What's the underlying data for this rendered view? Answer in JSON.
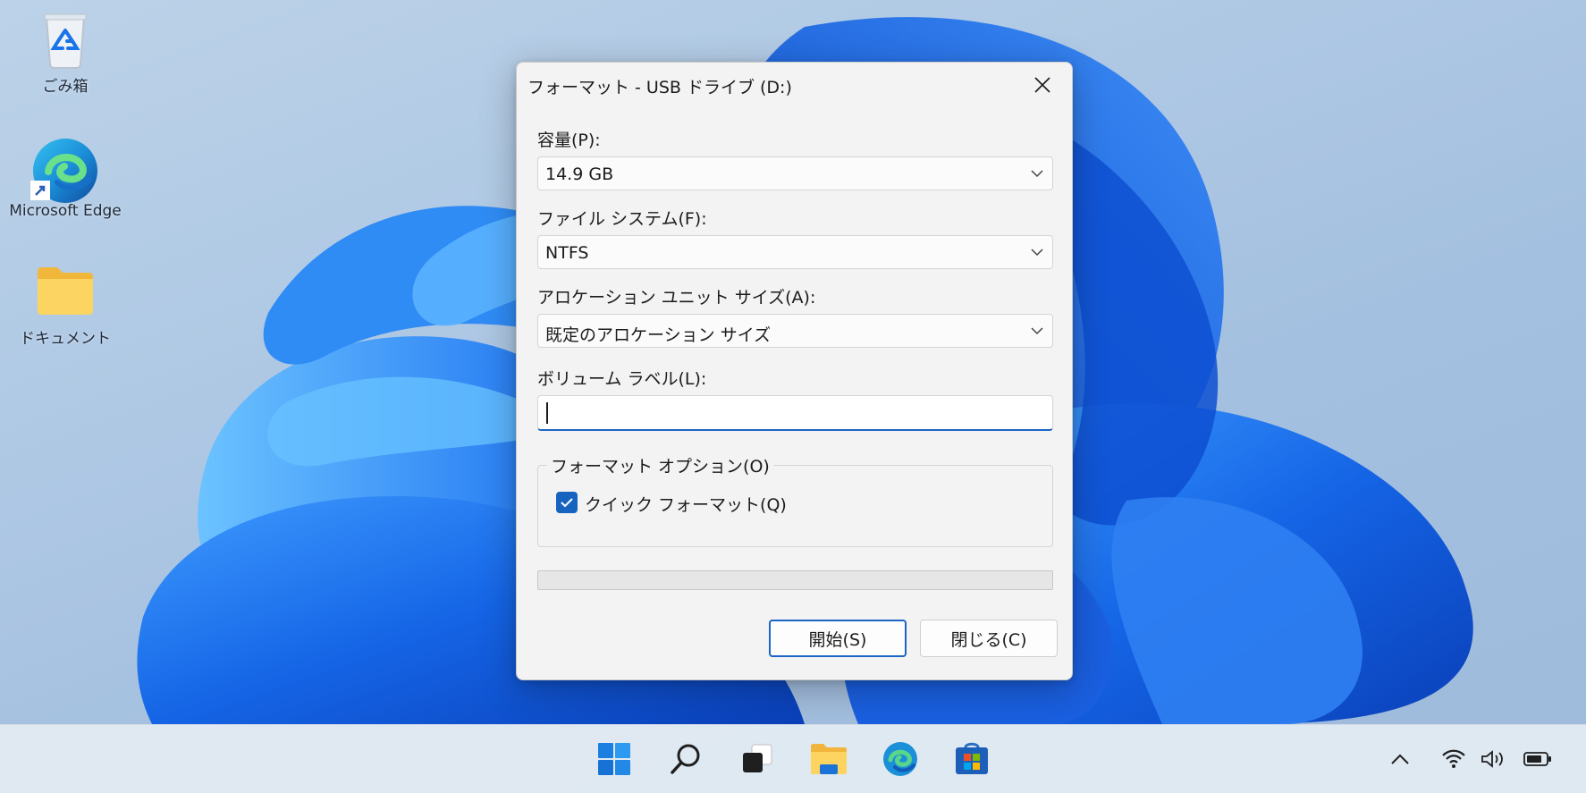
{
  "desktop": {
    "icons": [
      {
        "label": "ごみ箱",
        "icon": "recycle-bin-icon"
      },
      {
        "label": "Microsoft Edge",
        "icon": "edge-icon"
      },
      {
        "label": "ドキュメント",
        "icon": "folder-icon"
      }
    ]
  },
  "dialog": {
    "title": "フォーマット - USB ドライブ (D:)",
    "capacity": {
      "label": "容量(P):",
      "value": "14.9 GB"
    },
    "filesystem": {
      "label": "ファイル システム(F):",
      "value": "NTFS"
    },
    "allocation": {
      "label": "アロケーション ユニット サイズ(A):",
      "value": "既定のアロケーション サイズ"
    },
    "volume": {
      "label": "ボリューム ラベル(L):",
      "value": ""
    },
    "options": {
      "legend": "フォーマット オプション(O)",
      "quick_format_label": "クイック フォーマット(Q)",
      "quick_format_checked": true
    },
    "progress": {
      "value_percent": 0
    },
    "buttons": {
      "start": "開始(S)",
      "close": "閉じる(C)"
    }
  },
  "taskbar": {
    "apps": [
      "start-icon",
      "search-icon",
      "task-view-icon",
      "file-explorer-icon",
      "edge-icon",
      "store-icon"
    ],
    "tray": [
      "chevron-up-icon",
      "wifi-icon",
      "volume-icon",
      "battery-icon"
    ]
  },
  "colors": {
    "accent": "#1d64c5",
    "dialog_bg": "#f3f3f3"
  }
}
